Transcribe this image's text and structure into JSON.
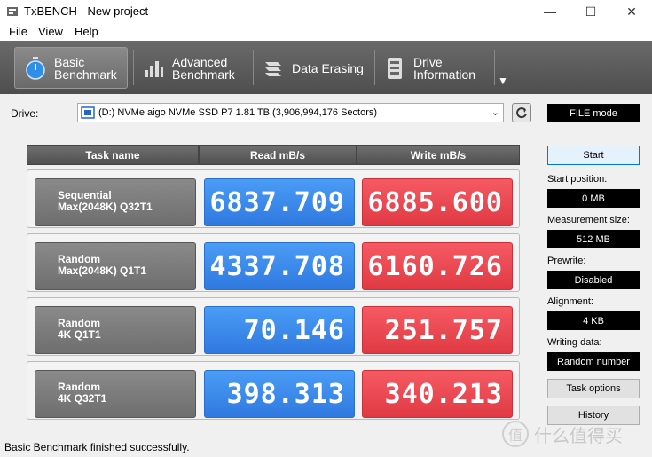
{
  "window": {
    "title": "TxBENCH - New project",
    "controls": {
      "minimize": "—",
      "maximize": "☐",
      "close": "✕"
    }
  },
  "menu": [
    "File",
    "View",
    "Help"
  ],
  "toolbar": {
    "tabs": [
      {
        "line1": "Basic",
        "line2": "Benchmark",
        "icon": "stopwatch-icon",
        "active": true
      },
      {
        "line1": "Advanced",
        "line2": "Benchmark",
        "icon": "bar-chart-icon",
        "active": false
      },
      {
        "line1": "Data Erasing",
        "line2": "",
        "icon": "eraser-icon",
        "active": false
      },
      {
        "line1": "Drive",
        "line2": "Information",
        "icon": "drive-info-icon",
        "active": false
      }
    ],
    "more": "▼"
  },
  "drive": {
    "label": "Drive:",
    "selected": "(D:) NVMe aigo NVMe SSD P7  1.81 TB (3,906,994,176 Sectors)",
    "mode": "FILE mode"
  },
  "table": {
    "headers": {
      "task": "Task name",
      "read": "Read mB/s",
      "write": "Write mB/s"
    },
    "rows": [
      {
        "line1": "Sequential",
        "line2": "Max(2048K) Q32T1",
        "read": "6837.709",
        "write": "6885.600"
      },
      {
        "line1": "Random",
        "line2": "Max(2048K) Q1T1",
        "read": "4337.708",
        "write": "6160.726"
      },
      {
        "line1": "Random",
        "line2": "4K Q1T1",
        "read": "70.146",
        "write": "251.757"
      },
      {
        "line1": "Random",
        "line2": "4K Q32T1",
        "read": "398.313",
        "write": "340.213"
      }
    ]
  },
  "side": {
    "start": "Start",
    "start_position_label": "Start position:",
    "start_position": "0 MB",
    "measurement_size_label": "Measurement size:",
    "measurement_size": "512 MB",
    "prewrite_label": "Prewrite:",
    "prewrite": "Disabled",
    "alignment_label": "Alignment:",
    "alignment": "4 KB",
    "writing_data_label": "Writing data:",
    "writing_data": "Random number",
    "task_options": "Task options",
    "history": "History"
  },
  "status": "Basic Benchmark finished successfully.",
  "watermark": {
    "logo": "值",
    "text": "什么值得买"
  },
  "colors": {
    "read": "#3a86ec",
    "write": "#ec4750",
    "toolbar": "#5c5c5c"
  }
}
